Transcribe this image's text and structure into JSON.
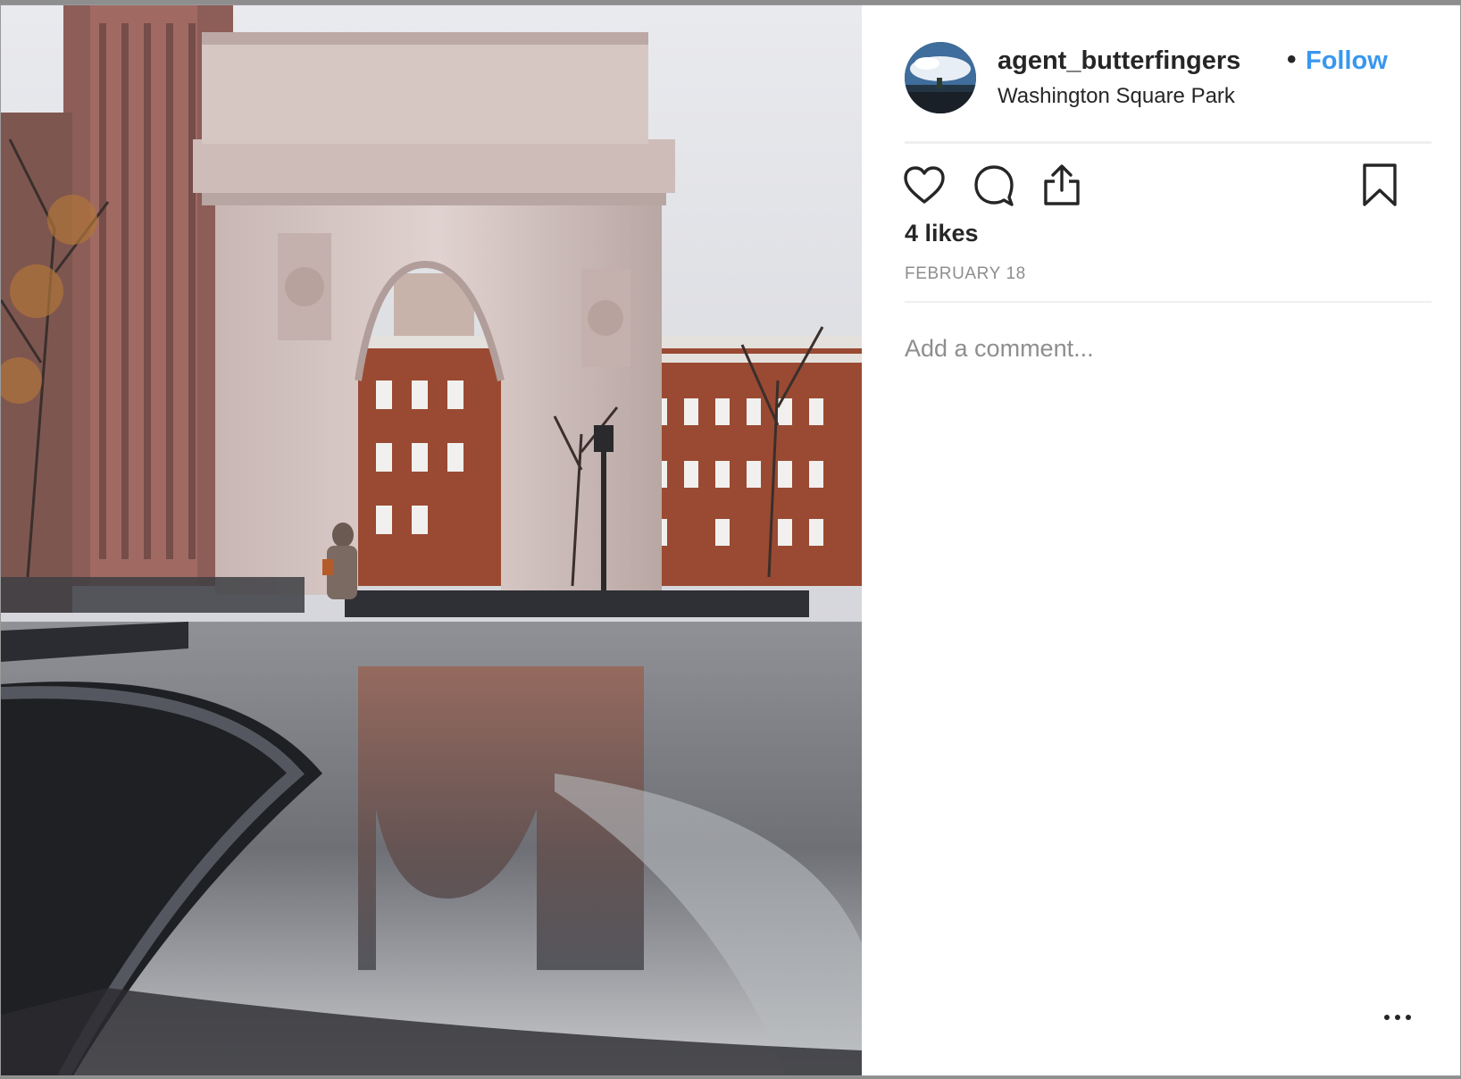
{
  "post": {
    "username": "agent_butterfingers",
    "separator": "•",
    "follow_label": "Follow",
    "location": "Washington Square Park",
    "likes": "4 likes",
    "date": "FEBRUARY 18",
    "comment_placeholder": "Add a comment..."
  },
  "photo": {
    "description_icon": "photo-washington-square-arch"
  },
  "icons": {
    "like": "heart-icon",
    "comment": "comment-icon",
    "share": "share-icon",
    "save": "bookmark-icon",
    "more": "more-options-icon"
  },
  "colors": {
    "link": "#3897f0",
    "text": "#262626",
    "muted": "#8e8e8e",
    "divider": "#efefef"
  }
}
